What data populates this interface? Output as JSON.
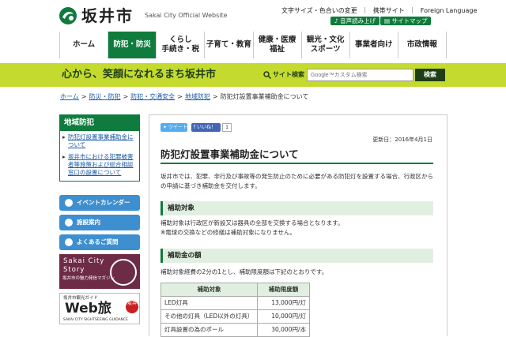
{
  "header": {
    "site_name": "坂井市",
    "site_sub": "Sakai City Official Website",
    "util_links": [
      "文字サイズ・色合いの変更",
      "携帯サイト",
      "Foreign Language"
    ],
    "voice_button": "音声読み上げ",
    "sitemap_button": "サイトマップ"
  },
  "nav": {
    "items": [
      {
        "label": "ホーム"
      },
      {
        "label": "防犯・防災"
      },
      {
        "label": "くらし\n手続き・税"
      },
      {
        "label": "子育て・教育"
      },
      {
        "label": "健康・医療\n福祉"
      },
      {
        "label": "観光・文化\nスポーツ"
      },
      {
        "label": "事業者向け"
      },
      {
        "label": "市政情報"
      }
    ],
    "active_index": 1
  },
  "banner": {
    "tagline": "心から、笑顔になれるまち坂井市",
    "search_label": "サイト検索",
    "search_placeholder": "Google™カスタム検索",
    "search_button": "検索"
  },
  "breadcrumb": [
    "ホーム",
    "防災・防犯",
    "防犯・交通安全",
    "地域防犯",
    "防犯灯設置事業補助金について"
  ],
  "sidebar": {
    "title": "地域防犯",
    "links": [
      "防犯灯設置事業補助金について",
      "坂井市における犯罪被害者等施策および総合相談窓口の設置について"
    ],
    "buttons": [
      "イベントカレンダー",
      "施設案内",
      "よくあるご質問"
    ],
    "banner_story": {
      "line1": "Sakai City",
      "line2": "Story",
      "line3": "坂井市の魅力発信マガジン"
    },
    "banner_webtabi": {
      "line1": "坂井市観光ガイド",
      "line2": "Web旅",
      "line3": "SAKAI CITY SIGHTSEEING GUIDANCE",
      "badge": "坂井"
    }
  },
  "main": {
    "tweet": "ツイート",
    "like": "いいね！",
    "like_count": "1",
    "updated": "更新日：2016年4月1日",
    "title": "防犯灯設置事業補助金について",
    "intro": "坂井市では、犯罪、非行及び事故等の発生防止のために必要がある防犯灯を設置する場合、行政区からの申請に基づき補助金を交付します。",
    "section1_heading": "補助対象",
    "section1_text": "補助対象は行政区が新設又は器具の全部を交換する場合となります。",
    "section1_note": "※電球の交換などの修繕は補助対象になりません。",
    "section2_heading": "補助金の額",
    "section2_text": "補助対象経費の2分の1とし、補助限度額は下記のとおりです。",
    "table": {
      "headers": [
        "補助対象",
        "補助限度額"
      ],
      "rows": [
        [
          "LED灯具",
          "13,000円/灯"
        ],
        [
          "その他の灯具（LED以外の灯具）",
          "10,000円/灯"
        ],
        [
          "灯具設置の為のポール",
          "30,000円/本"
        ]
      ]
    }
  }
}
